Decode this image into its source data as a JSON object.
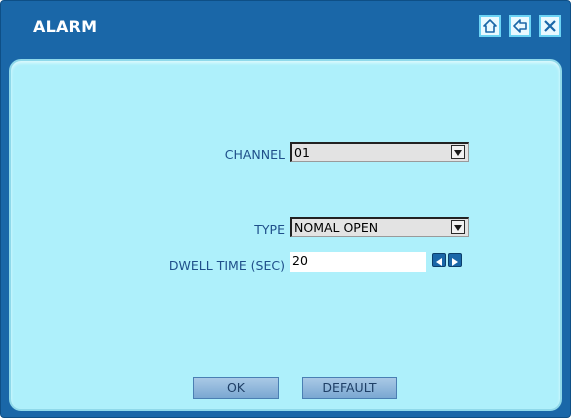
{
  "window": {
    "title": "ALARM",
    "icons": [
      "home-icon",
      "back-arrow-icon",
      "close-icon"
    ]
  },
  "form": {
    "channel_label": "CHANNEL",
    "channel_value": "01",
    "type_label": "TYPE",
    "type_value": "NOMAL OPEN",
    "dwell_label": "DWELL TIME (SEC)",
    "dwell_value": "20"
  },
  "buttons": {
    "ok_label": "OK",
    "default_label": "DEFAULT"
  },
  "colors": {
    "titlebar": "#1a67a8",
    "panel": "#aef0fb",
    "label_text": "#1f4f8a"
  }
}
